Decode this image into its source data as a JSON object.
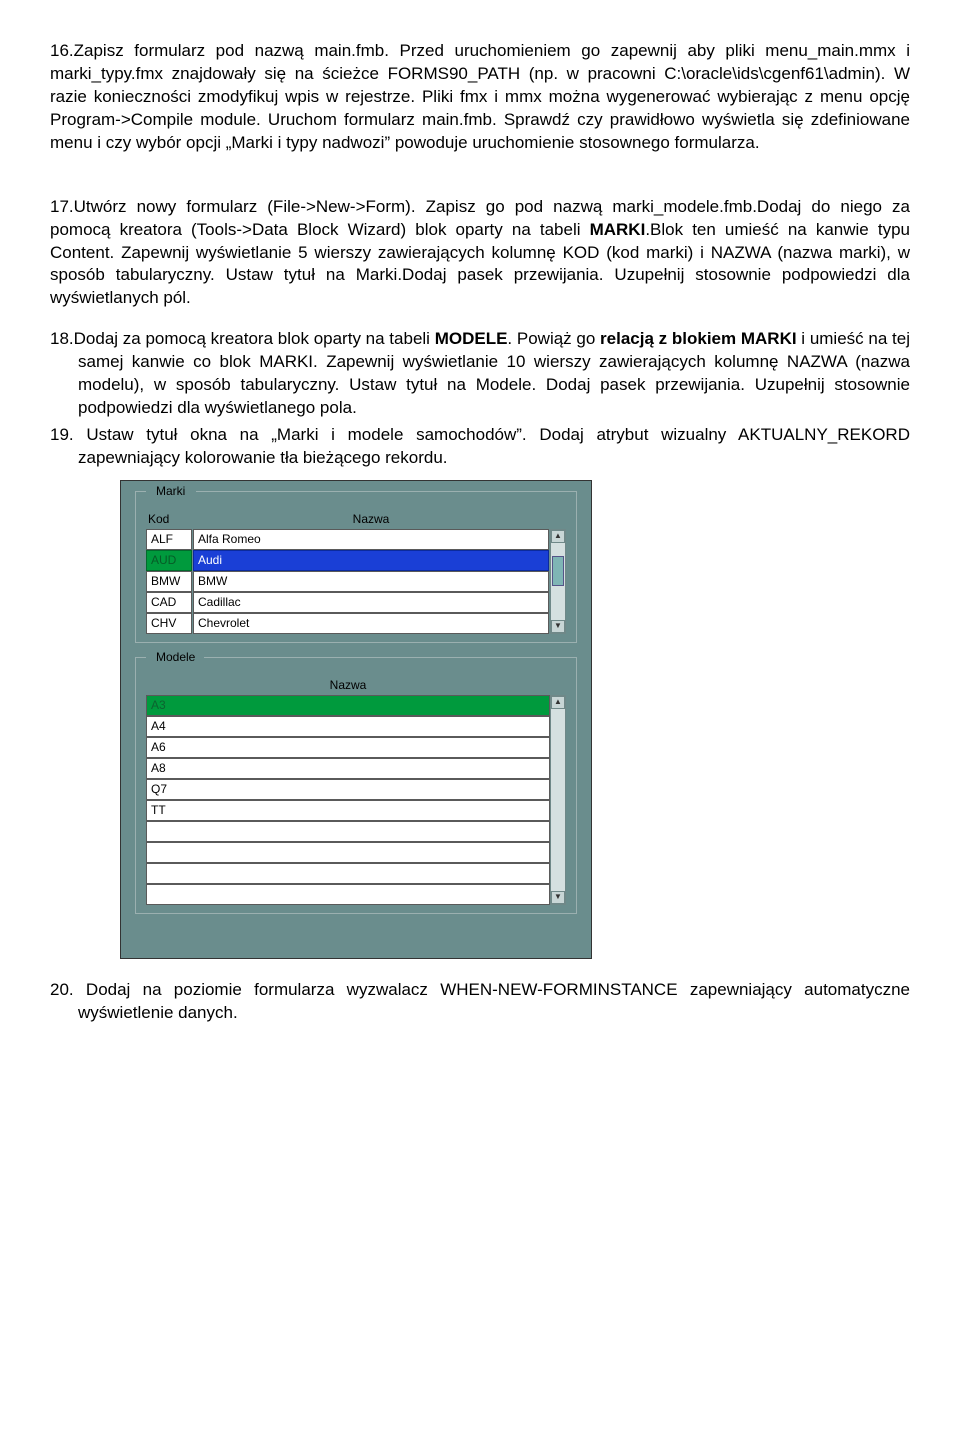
{
  "items": {
    "i16": {
      "num": "16.",
      "text_a": "Zapisz formularz pod nazwą main.fmb. Przed uruchomieniem go zapewnij aby pliki menu_main.mmx i marki_typy.fmx znajdowały się na ścieżce FORMS90_PATH (np. w pracowni C:\\oracle\\ids\\cgenf61\\admin). W razie konieczności zmodyfikuj wpis w rejestrze. Pliki fmx i mmx można wygenerować wybierając z menu opcję Program->Compile module. Uruchom formularz main.fmb. Sprawdź czy prawidłowo wyświetla się zdefiniowane menu i czy wybór opcji „Marki i typy nadwozi” powoduje uruchomienie stosownego formularza."
    },
    "i17": {
      "num": "17.",
      "text_a": "Utwórz nowy formularz (File->New->Form). Zapisz go pod nazwą marki_modele.fmb.Dodaj do niego za pomocą kreatora (Tools->Data Block Wizard) blok oparty na tabeli ",
      "mark": "MARKI",
      "text_b": ".Blok ten umieść na kanwie typu Content. Zapewnij wyświetlanie 5 wierszy zawierających kolumnę KOD (kod marki) i NAZWA (nazwa marki), w sposób tabularyczny. Ustaw tytuł na Marki.Dodaj pasek przewijania. Uzupełnij stosownie podpowiedzi dla wyświetlanych pól."
    },
    "i18": {
      "num": "18.",
      "text_a": "Dodaj za pomocą kreatora blok oparty na tabeli ",
      "mark1": "MODELE",
      "text_b": ". Powiąż go ",
      "mark2": "relacją z blokiem MARKI",
      "text_c": " i umieść na tej samej kanwie co blok MARKI. Zapewnij wyświetlanie 10 wierszy zawierających kolumnę NAZWA (nazwa modelu), w sposób tabularyczny. Ustaw tytuł na Modele. Dodaj pasek przewijania. Uzupełnij stosownie podpowiedzi dla wyświetlanego pola."
    },
    "i19": {
      "num": "19.",
      "text_a": " Ustaw tytuł okna na „Marki i modele samochodów”. Dodaj atrybut wizualny AKTUALNY_REKORD zapewniający kolorowanie tła bieżącego rekordu."
    },
    "i20": {
      "num": "20.",
      "text_a": " Dodaj na poziomie formularza wyzwalacz WHEN-NEW-FORMINSTANCE zapewniający automatyczne wyświetlenie danych."
    }
  },
  "form": {
    "marki": {
      "legend": "Marki",
      "col_kod": "Kod",
      "col_nazwa": "Nazwa",
      "rows": [
        {
          "kod": "ALF",
          "nazwa": "Alfa Romeo"
        },
        {
          "kod": "AUD",
          "nazwa": "Audi"
        },
        {
          "kod": "BMW",
          "nazwa": "BMW"
        },
        {
          "kod": "CAD",
          "nazwa": "Cadillac"
        },
        {
          "kod": "CHV",
          "nazwa": "Chevrolet"
        }
      ],
      "selected_index": 1
    },
    "modele": {
      "legend": "Modele",
      "col_nazwa": "Nazwa",
      "rows": [
        "A3",
        "A4",
        "A6",
        "A8",
        "Q7",
        "TT",
        "",
        "",
        "",
        ""
      ],
      "selected_index": 0
    },
    "scroll_up": "▲",
    "scroll_down": "▼"
  }
}
